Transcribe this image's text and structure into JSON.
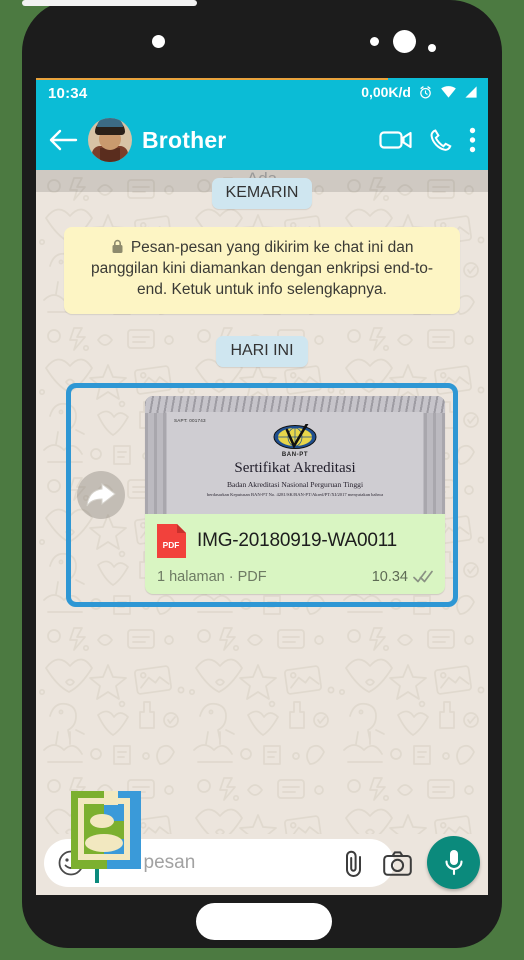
{
  "app": {
    "name": "WhatsApp",
    "accent_color": "#0bbcd6",
    "wallpaper_color": "#ece5dd",
    "outgoing_bubble_color": "#d9f5c2",
    "selection_color": "#2e97d4"
  },
  "status_bar": {
    "time": "10:34",
    "data_rate": "0,00K/d",
    "icons": [
      "alarm-icon",
      "wifi-icon",
      "signal-icon"
    ]
  },
  "header": {
    "back_icon": "back-arrow-icon",
    "contact_name": "Brother",
    "avatar": "contact-avatar",
    "actions": [
      {
        "name": "video-call-icon",
        "label": "Video call"
      },
      {
        "name": "voice-call-icon",
        "label": "Voice call"
      },
      {
        "name": "overflow-menu-icon",
        "label": "More options"
      }
    ]
  },
  "chat": {
    "partial_message_above": "Ada",
    "date_chip_yesterday": "KEMARIN",
    "date_chip_today": "HARI INI",
    "encryption_notice": "Pesan-pesan yang dikirim ke chat ini dan panggilan kini diamankan dengan enkripsi end-to-end. Ketuk untuk info selengkapnya.",
    "encryption_lock_icon": "lock-icon",
    "document_message": {
      "selected": true,
      "forward_icon": "forward-arrow-icon",
      "file_type_badge": "PDF",
      "filename": "IMG-20180919-WA0011",
      "meta": "1 halaman · PDF",
      "time": "10.34",
      "status_icon": "double-check-icon",
      "preview": {
        "serial": "SAPT: 001743",
        "org": "BAN-PT",
        "title": "Sertifikat Akreditasi",
        "subtitle": "Badan Akreditasi Nasional Perguruan Tinggi",
        "fine_print": "berdasarkan Keputusan BAN-PT No. 4281/SK/BAN-PT/Akred/PT/XI/2017 menyatakan bahwa",
        "fine_print_2": ""
      }
    }
  },
  "input_bar": {
    "emoji_icon": "emoji-icon",
    "placeholder": "Ketik pesan",
    "value": "",
    "attach_icon": "attach-clip-icon",
    "camera_icon": "camera-icon",
    "mic_icon": "microphone-icon"
  },
  "watermark": {
    "name": "app-logo-watermark",
    "colors": [
      "#7cb02f",
      "#f2e8c0",
      "#3a9ad9"
    ]
  }
}
